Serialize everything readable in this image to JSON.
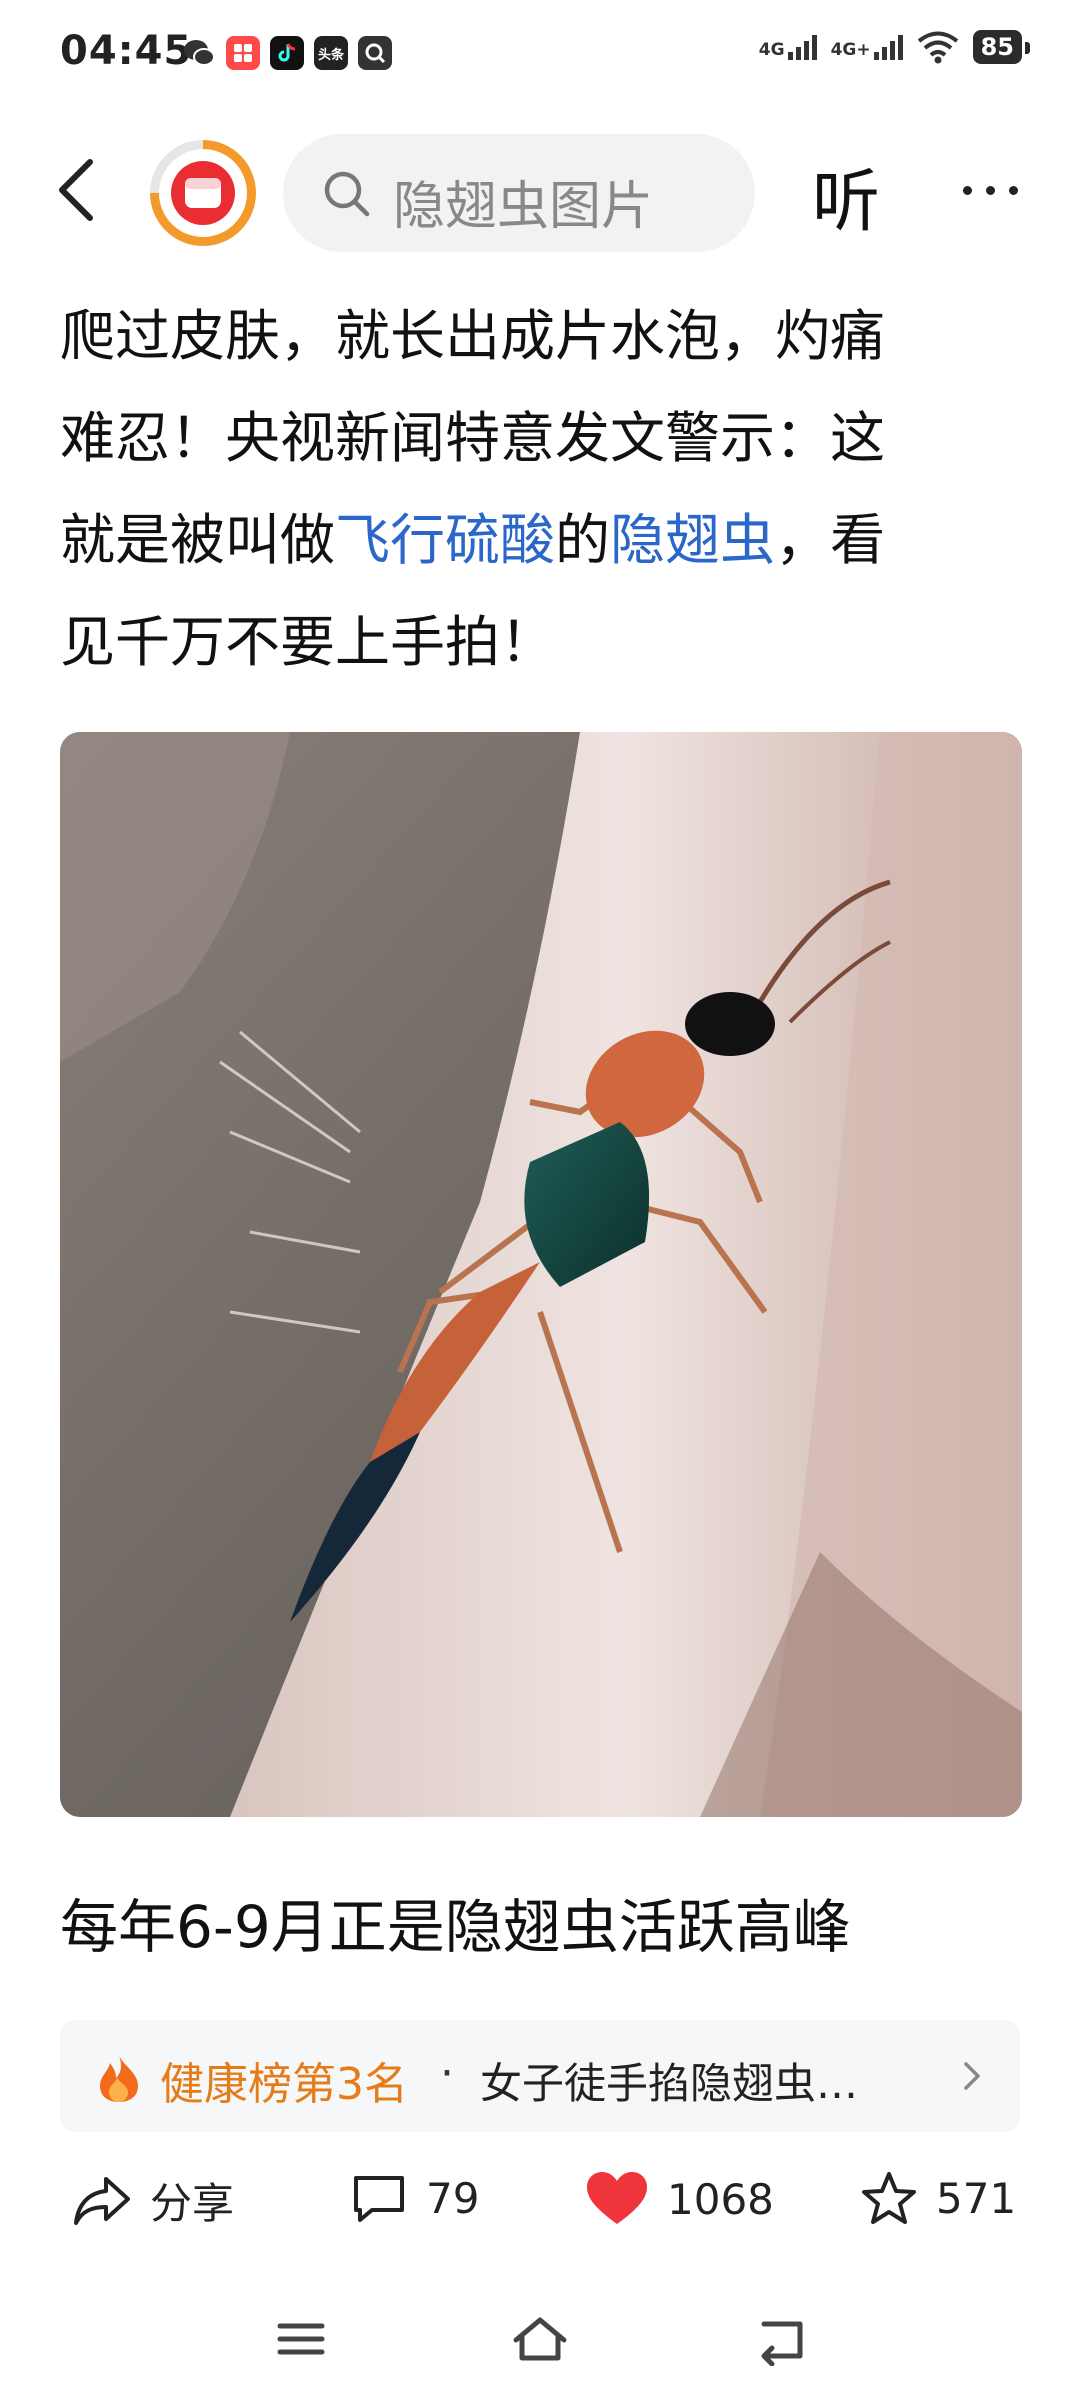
{
  "status": {
    "time": "04:45",
    "network1": "4G",
    "network2": "4G+",
    "battery": "85",
    "app_icons": [
      "wechat-icon",
      "xiaohongshu-icon",
      "douyin-icon",
      "toutiao-icon",
      "search-app-icon"
    ],
    "toutiao_label": "头条"
  },
  "topbar": {
    "search_placeholder": "隐翅虫图片",
    "listen_label": "听"
  },
  "article": {
    "line1": "爬过皮肤，就长出成片水泡，灼痛",
    "line2": "难忍！央视新闻特意发文警示：这",
    "line3_a": "就是被叫做",
    "line3_link1": "飞行硫酸",
    "line3_b": "的",
    "line3_link2": "隐翅虫",
    "line3_c": "，看",
    "line4": "见千万不要上手拍！",
    "para2": "每年6-9月正是隐翅虫活跃高峰"
  },
  "rank": {
    "label": "健康榜第3名",
    "separator": "·",
    "title": "女子徒手掐隐翅虫…"
  },
  "actions": {
    "share": "分享",
    "comments": "79",
    "likes": "1068",
    "favorites": "571"
  },
  "colors": {
    "link": "#2b67c9",
    "rank_label": "#e47c1a",
    "like": "#f0343c",
    "brand": "#ea2c33"
  }
}
